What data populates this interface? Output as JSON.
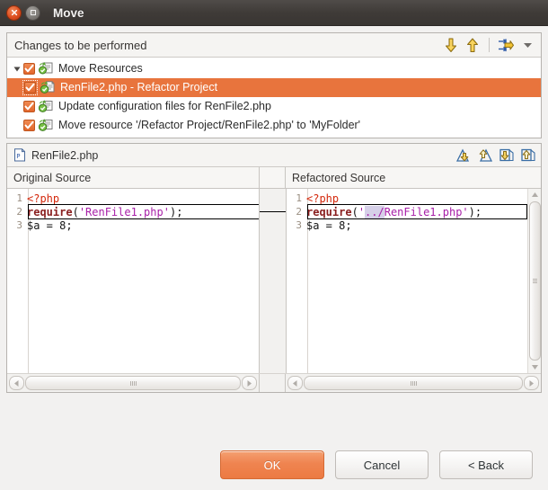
{
  "window": {
    "title": "Move",
    "close_icon": "close-icon",
    "maximize_icon": "maximize-icon"
  },
  "changes": {
    "header_title": "Changes to be performed",
    "tools": [
      {
        "name": "next-change-down-button",
        "icon": "arrow-down-icon",
        "tooltip": "Next Change"
      },
      {
        "name": "previous-change-up-button",
        "icon": "arrow-up-icon",
        "tooltip": "Previous Change"
      },
      {
        "name": "filter-changes-button",
        "icon": "filter-icon",
        "tooltip": "Filter Changes"
      },
      {
        "name": "view-menu-button",
        "icon": "chevron-down-icon",
        "tooltip": "View Menu"
      }
    ],
    "tree": [
      {
        "label": "Move Resources",
        "level": 0,
        "checked": true,
        "expanded": true,
        "selected": false,
        "icon": "refactoring-composite-icon"
      },
      {
        "label": "RenFile2.php - Refactor Project",
        "level": 1,
        "checked": true,
        "selected": true,
        "focused": true,
        "icon": "refactoring-file-icon"
      },
      {
        "label": "Update configuration files for RenFile2.php",
        "level": 1,
        "checked": true,
        "selected": false,
        "icon": "refactoring-change-icon"
      },
      {
        "label": "Move resource '/Refactor Project/RenFile2.php' to 'MyFolder'",
        "level": 1,
        "checked": true,
        "selected": false,
        "icon": "refactoring-change-icon"
      }
    ]
  },
  "compare": {
    "file_icon": "php-file-icon",
    "file_name": "RenFile2.php",
    "tools": [
      {
        "name": "next-difference-button",
        "icon": "next-difference-icon"
      },
      {
        "name": "previous-difference-button",
        "icon": "previous-difference-icon"
      },
      {
        "name": "next-change-button",
        "icon": "next-change-icon"
      },
      {
        "name": "previous-change-button",
        "icon": "previous-change-icon"
      }
    ],
    "columns": {
      "left": "Original Source",
      "right": "Refactored Source"
    },
    "left_source": {
      "lines": [
        {
          "num": "1",
          "tokens": [
            {
              "text": "<?php",
              "style": "php"
            }
          ]
        },
        {
          "num": "2",
          "changed": true,
          "tokens": [
            {
              "text": "require",
              "style": "kw"
            },
            {
              "text": "(",
              "style": "punct"
            },
            {
              "text": "'RenFile1.php'",
              "style": "str"
            },
            {
              "text": ");",
              "style": "punct"
            }
          ]
        },
        {
          "num": "3",
          "tokens": [
            {
              "text": "$a = 8;",
              "style": "plain"
            }
          ]
        }
      ]
    },
    "right_source": {
      "lines": [
        {
          "num": "1",
          "tokens": [
            {
              "text": "<?php",
              "style": "php"
            }
          ]
        },
        {
          "num": "2",
          "changed": true,
          "tokens": [
            {
              "text": "require",
              "style": "kw"
            },
            {
              "text": "(",
              "style": "punct"
            },
            {
              "text": "'",
              "style": "str"
            },
            {
              "text": "../",
              "style": "str-hl"
            },
            {
              "text": "RenFile1.php'",
              "style": "str"
            },
            {
              "text": ");",
              "style": "punct"
            }
          ]
        },
        {
          "num": "3",
          "tokens": [
            {
              "text": "$a = 8;",
              "style": "plain"
            }
          ]
        }
      ]
    },
    "scrollbars": {
      "vertical_up_icon": "scroll-up-icon",
      "vertical_down_icon": "scroll-down-icon",
      "horizontal_left_icon": "scroll-left-icon",
      "horizontal_right_icon": "scroll-right-icon"
    }
  },
  "footer": {
    "ok_label": "OK",
    "cancel_label": "Cancel",
    "back_label": "< Back"
  },
  "colors": {
    "selection": "#e8743d",
    "primary_button": "#ef8450",
    "checkbox": "#e2662c",
    "php_tag": "#d4290d",
    "keyword": "#8a2020",
    "string": "#a820a8",
    "highlight": "#d6d0e8"
  }
}
